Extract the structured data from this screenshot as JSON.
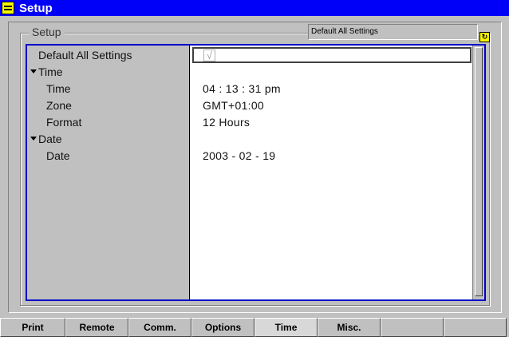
{
  "window": {
    "title": "Setup"
  },
  "group": {
    "label": "Setup"
  },
  "header_field": {
    "value": "Default All Settings"
  },
  "tree": {
    "rows": [
      {
        "label": "Default All Settings",
        "value": ""
      },
      {
        "label": "Time",
        "expanded": true
      },
      {
        "label": "Time",
        "value": "04 : 13 : 31 pm"
      },
      {
        "label": "Zone",
        "value": "GMT+01:00"
      },
      {
        "label": "Format",
        "value": "12 Hours"
      },
      {
        "label": "Date",
        "expanded": true
      },
      {
        "label": "Date",
        "value": "2003 - 02 - 19"
      }
    ],
    "checkbox_mark": "√"
  },
  "tabs": [
    {
      "label": "Print"
    },
    {
      "label": "Remote"
    },
    {
      "label": "Comm."
    },
    {
      "label": "Options"
    },
    {
      "label": "Time",
      "active": true
    },
    {
      "label": "Misc."
    },
    {
      "label": ""
    },
    {
      "label": ""
    }
  ],
  "colors": {
    "titlebar": "#0000f8",
    "frame": "#0000c8",
    "background": "#c0c0c0"
  }
}
